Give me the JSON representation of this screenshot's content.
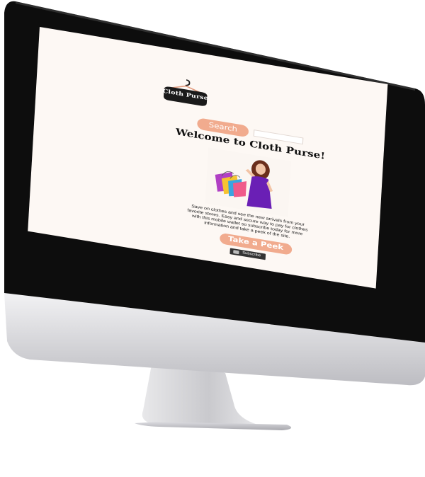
{
  "site": {
    "logo_text": "Cloth Purse",
    "search_label": "Search",
    "search_placeholder": "",
    "heading": "Welcome to Cloth Purse!",
    "description": "Save on clothes and see the new arrivals from your favorite stores. Easy and secure way to pay for clothes with this mobile wallet so subscribe today for more information and take a peek of the site.",
    "cta_label": "Take a Peek",
    "subscribe_label": "Subscribe"
  },
  "colors": {
    "accent": "#f1ab8e",
    "page_background": "#fdf8f4",
    "logo_badge": "#1a1a1a",
    "monitor_bezel": "#0d0d0d",
    "monitor_silver": "#d8d8dc"
  },
  "icons": {
    "logo": "hanger-icon",
    "camera": "webcam-icon",
    "subscribe": "youtube-icon"
  }
}
